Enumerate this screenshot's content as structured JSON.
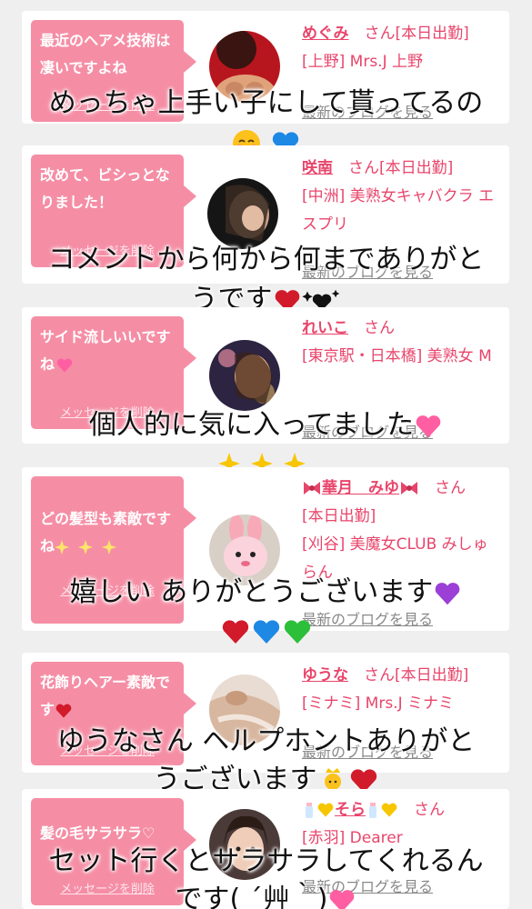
{
  "entries": [
    {
      "message": "最近のヘアメ技術は凄いですよね",
      "delete_label": "メッセージを削除",
      "name": "めぐみ",
      "san": "さん",
      "status": "[本日出勤]",
      "shop": "[上野] Mrs.J 上野",
      "blog_label": "最新のブログを見る",
      "caption": "めっちゃ上手い子にして貰ってるの"
    },
    {
      "message": "改めて、ビシっとなりました！",
      "delete_label": "メッセージを削除",
      "name": "咲南",
      "san": "さん",
      "status": "[本日出勤]",
      "shop": "[中洲] 美熟女キャバクラ エスプリ",
      "blog_label": "最新のブログを見る",
      "caption_line1": "コメントから何から何までありがと",
      "caption_line2": "うです"
    },
    {
      "message": "サイド流しいいですね",
      "delete_label": "メッセージを削除",
      "name": "れいこ",
      "san": "さん",
      "shop": "[東京駅・日本橋] 美熟女 M",
      "blog_label": "最新のブログを見る",
      "caption": "個人的に気に入ってました"
    },
    {
      "message": "どの髪型も素敵ですね",
      "delete_label": "メッセージを削除",
      "name": "華月　みゆ",
      "san": "さん",
      "status": "[本日出勤]",
      "shop": "[刈谷] 美魔女CLUB みしゅらん",
      "blog_label": "最新のブログを見る",
      "caption": "嬉しい ありがとうございます"
    },
    {
      "message": "花飾りヘアー素敵です",
      "delete_label": "メッセージを削除",
      "name": "ゆうな",
      "san": "さん",
      "status": "[本日出勤]",
      "shop": "[ミナミ] Mrs.J ミナミ",
      "blog_label": "最新のブログを見る",
      "caption_line1": "ゆうなさん ヘルプホントありがと",
      "caption_line2": "うございます"
    },
    {
      "message": "髪の毛サラサラ♡",
      "delete_label": "メッセージを削除",
      "name": "そら",
      "san": "さん",
      "shop": "[赤羽] Dearer",
      "blog_label": "最新のブログを見る",
      "caption_line1": "セット行くとサラサラしてくれるん",
      "caption_line2": "です( ´艸｀)"
    }
  ],
  "colors": {
    "bubble": "#f58ea5",
    "name": "#e8456b",
    "background": "#f0eff0"
  },
  "icons": [
    "relieved-face-icon",
    "blue-heart-icon",
    "red-heart-icon",
    "black-heart-icon",
    "sparkles-icon",
    "pink-heart-icon",
    "purple-heart-icon",
    "green-heart-icon",
    "ribbon-icon",
    "baby-bottle-icon",
    "yellow-heart-icon",
    "princess-icon"
  ]
}
